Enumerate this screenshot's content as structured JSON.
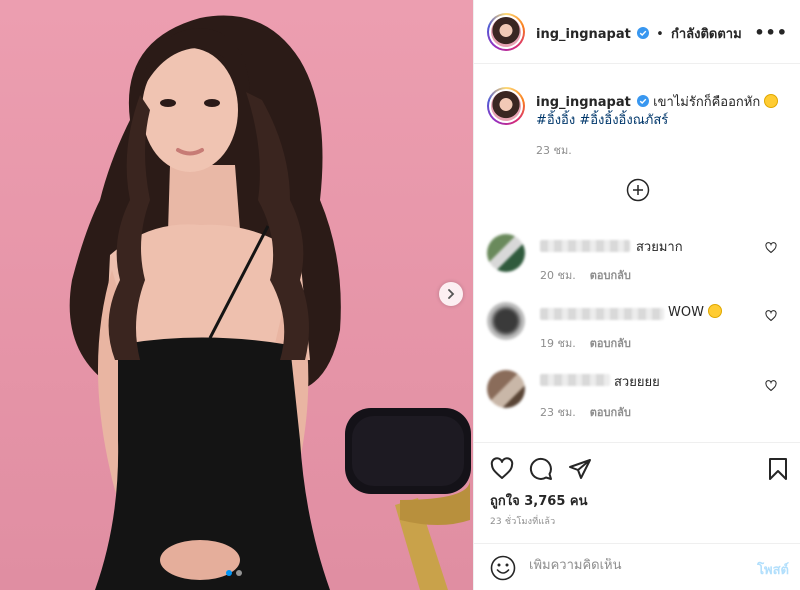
{
  "header": {
    "username": "ing_ingnapat",
    "separator": "•",
    "follow_status": "กำลังติดตาม",
    "more": "•••"
  },
  "caption": {
    "username": "ing_ingnapat",
    "text": "เขาไม่รักก็คืออกหัก",
    "hashtags": "#อิ้งอิ้ง #อิ้งอิ้งอิ้งณภัสร์",
    "time": "23 ชม."
  },
  "comments": [
    {
      "text": "สวยมาก",
      "time": "20 ชม.",
      "reply": "ตอบกลับ"
    },
    {
      "text": "WOW",
      "time": "19 ชม.",
      "reply": "ตอบกลับ"
    },
    {
      "text": "สวยยยย",
      "time": "23 ชม.",
      "reply": "ตอบกลับ"
    }
  ],
  "post": {
    "likes_label": "ถูกใจ",
    "likes_count": "3,765",
    "likes_unit": "คน",
    "posted_ago": "23 ชั่วโมงที่แล้ว"
  },
  "comment_box": {
    "placeholder": "เพิ่มความคิดเห็น",
    "post_label": "โพสต์"
  },
  "carousel": {
    "current": 1,
    "total": 2
  },
  "colors": {
    "accent": "#0095f6",
    "link": "#00376b",
    "muted": "#8e8e8e",
    "background_photo": "#e895a8"
  }
}
